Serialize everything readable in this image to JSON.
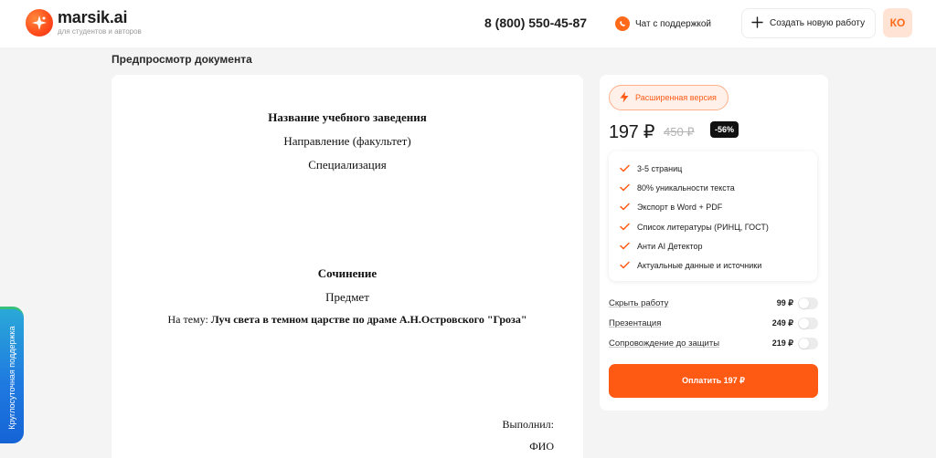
{
  "header": {
    "logo_name": "marsik.ai",
    "logo_tagline": "для студентов и авторов",
    "logo_icon": "sparkle-icon",
    "phone": "8 (800) 550-45-87",
    "chat_label": "Чат с поддержкой",
    "chat_icon": "whatsapp-icon",
    "new_work_label": "Создать новую работу",
    "new_work_icon": "plus-icon",
    "avatar_initials": "КО"
  },
  "page": {
    "section_title": "Предпросмотр документа"
  },
  "document": {
    "institution": "Название учебного заведения",
    "direction": "Направление (факультет)",
    "specialization": "Специализация",
    "work_type": "Сочинение",
    "subject": "Предмет",
    "topic_prefix": "На тему:",
    "topic": "Луч света в темном царстве по драме А.Н.Островского \"Гроза\"",
    "performed_label": "Выполнил:",
    "author_name": "ФИО"
  },
  "plan": {
    "badge_label": "Расширенная версия",
    "badge_icon": "lightning-icon",
    "price": "197 ₽",
    "old_price": "450 ₽",
    "discount": "-56%",
    "features": [
      "3-5 страниц",
      "80% уникальности текста",
      "Экспорт в Word + PDF",
      "Список литературы (РИНЦ, ГОСТ)",
      "Анти AI Детектор",
      "Актуальные данные и источники"
    ],
    "addons": [
      {
        "label": "Скрыть работу",
        "price": "99 ₽"
      },
      {
        "label": "Презентация",
        "price": "249 ₽"
      },
      {
        "label": "Сопровождение до защиты",
        "price": "219 ₽"
      }
    ],
    "pay_button": "Оплатить 197 ₽"
  },
  "support_tab": {
    "label": "Круглосуточная поддержка"
  },
  "colors": {
    "accent": "#ff5a14",
    "background": "#f4f4f5",
    "support_tab": "#1f7ae0"
  }
}
